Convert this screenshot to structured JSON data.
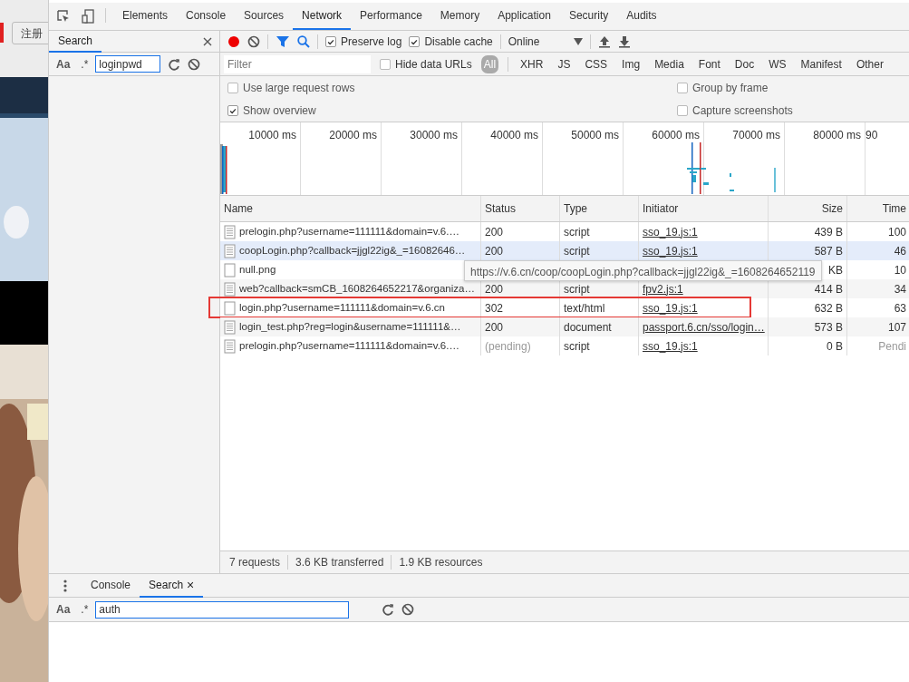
{
  "page": {
    "register_button": "注册"
  },
  "devtools": {
    "tabs": [
      {
        "label": "Elements",
        "selected": false
      },
      {
        "label": "Console",
        "selected": false
      },
      {
        "label": "Sources",
        "selected": false
      },
      {
        "label": "Network",
        "selected": true
      },
      {
        "label": "Performance",
        "selected": false
      },
      {
        "label": "Memory",
        "selected": false
      },
      {
        "label": "Application",
        "selected": false
      },
      {
        "label": "Security",
        "selected": false
      },
      {
        "label": "Audits",
        "selected": false
      }
    ]
  },
  "search_panel": {
    "tab": "Search",
    "match_case": "Aa",
    "regex": ".*",
    "query": "loginpwd"
  },
  "network": {
    "toolbar": {
      "recording": true,
      "checks": [
        {
          "label": "Preserve log",
          "checked": true
        },
        {
          "label": "Disable cache",
          "checked": true
        }
      ],
      "throttling": "Online"
    },
    "filter": {
      "placeholder": "Filter",
      "hide_data_urls": {
        "label": "Hide data URLs",
        "checked": false
      },
      "types": [
        {
          "label": "All",
          "selected": true
        },
        {
          "label": "XHR",
          "selected": false
        },
        {
          "label": "JS",
          "selected": false
        },
        {
          "label": "CSS",
          "selected": false
        },
        {
          "label": "Img",
          "selected": false
        },
        {
          "label": "Media",
          "selected": false
        },
        {
          "label": "Font",
          "selected": false
        },
        {
          "label": "Doc",
          "selected": false
        },
        {
          "label": "WS",
          "selected": false
        },
        {
          "label": "Manifest",
          "selected": false
        },
        {
          "label": "Other",
          "selected": false
        }
      ]
    },
    "options": [
      {
        "label": "Use large request rows",
        "checked": false
      },
      {
        "label": "Group by frame",
        "checked": false
      },
      {
        "label": "Show overview",
        "checked": true
      },
      {
        "label": "Capture screenshots",
        "checked": false
      }
    ],
    "overview": {
      "ticks": [
        "10000 ms",
        "20000 ms",
        "30000 ms",
        "40000 ms",
        "50000 ms",
        "60000 ms",
        "70000 ms",
        "80000 ms",
        "90"
      ]
    },
    "columns": [
      "Name",
      "Status",
      "Type",
      "Initiator",
      "Size",
      "Time"
    ],
    "rows": [
      {
        "name": "prelogin.php?username=111111&domain=v.6.…",
        "status": "200",
        "type": "script",
        "initiator": "sso_19.js:1",
        "size": "439 B",
        "time": "100",
        "kind": "script",
        "hovered": false,
        "pending": false,
        "marked": false
      },
      {
        "name": "coopLogin.php?callback=jjgl22ig&_=16082646…",
        "status": "200",
        "type": "script",
        "initiator": "sso_19.js:1",
        "size": "587 B",
        "time": "46",
        "kind": "script",
        "hovered": true,
        "pending": false,
        "marked": false
      },
      {
        "name": "null.png",
        "size": "KB",
        "time": "10",
        "kind": "blank",
        "hovered": false,
        "pending": false,
        "marked": false
      },
      {
        "name": "web?callback=smCB_1608264652217&organiza…",
        "status": "200",
        "type": "script",
        "initiator": "fpv2.js:1",
        "size": "414 B",
        "time": "34",
        "kind": "script",
        "hovered": false,
        "pending": false,
        "marked": false
      },
      {
        "name": "login.php?username=111111&domain=v.6.cn",
        "status": "302",
        "type": "text/html",
        "initiator": "sso_19.js:1",
        "size": "632 B",
        "time": "63",
        "kind": "blank",
        "hovered": false,
        "pending": false,
        "marked": true
      },
      {
        "name": "login_test.php?reg=login&username=111111&…",
        "status": "200",
        "type": "document",
        "initiator": "passport.6.cn/sso/login…",
        "size": "573 B",
        "time": "107",
        "kind": "script",
        "hovered": false,
        "pending": false,
        "marked": false
      },
      {
        "name": "prelogin.php?username=111111&domain=v.6.…",
        "status": "(pending)",
        "type": "script",
        "initiator": "sso_19.js:1",
        "size": "0 B",
        "time": "Pendi",
        "kind": "script",
        "hovered": false,
        "pending": true,
        "marked": false
      }
    ],
    "tooltip": "https://v.6.cn/coop/coopLogin.php?callback=jjgl22ig&_=1608264652119",
    "summary": [
      "7 requests",
      "3.6 KB transferred",
      "1.9 KB resources"
    ]
  },
  "drawer": {
    "tabs": [
      {
        "label": "Console",
        "selected": false,
        "closable": false
      },
      {
        "label": "Search",
        "selected": true,
        "closable": true
      }
    ],
    "close": "×",
    "match_case": "Aa",
    "regex": ".*",
    "query": "auth"
  }
}
